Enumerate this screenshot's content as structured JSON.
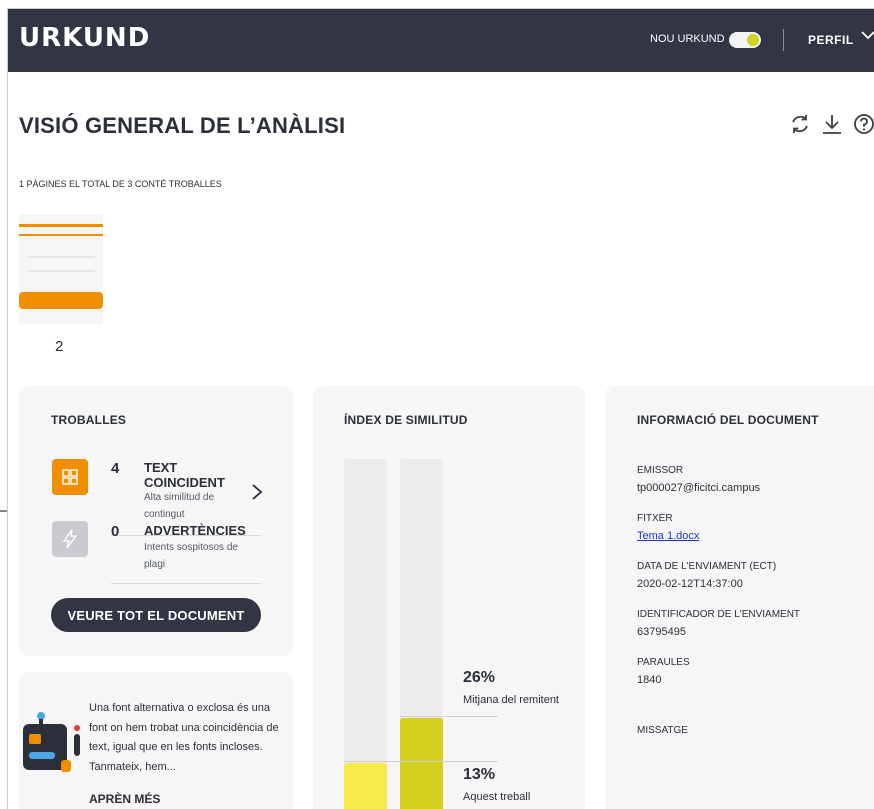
{
  "header": {
    "logo": "URKUND",
    "new_urkund_label": "NOU URKUND",
    "profile_label": "PERFIL"
  },
  "page": {
    "title": "VISIÓ GENERAL DE L’ANÀLISI",
    "subtitle": "1 PÀGINES EL TOTAL DE 3 CONTÉ TROBALLES",
    "thumbnail_number": "2"
  },
  "troballes": {
    "title": "TROBALLES",
    "items": [
      {
        "count": "4",
        "label_line1": "TEXT",
        "label_line2": "COINCIDENT",
        "desc_line1": "Alta similitud de",
        "desc_line2": "contingut",
        "icon": "grid-icon"
      },
      {
        "count": "0",
        "label_line1": "ADVERTÈNCIES",
        "desc_line1": "Intents sospitosos de",
        "desc_line2": "plagi",
        "icon": "lightning-icon"
      }
    ],
    "button_label": "VEURE TOT EL DOCUMENT"
  },
  "index": {
    "title": "ÍNDEX DE SIMILITUD",
    "avg_value": "26%",
    "avg_label": "Mitjana del remitent",
    "work_value": "13%",
    "work_label": "Aquest treball"
  },
  "chart_data": {
    "type": "bar",
    "categories": [
      "Aquest treball",
      "Mitjana del remitent"
    ],
    "values": [
      13,
      26
    ],
    "ylim": [
      0,
      100
    ]
  },
  "info": {
    "title": "INFORMACIÓ DEL DOCUMENT",
    "fields": [
      {
        "label": "EMISSOR",
        "value": "tp000027@ficitci.campus"
      },
      {
        "label": "FITXER",
        "value": "Tema 1.docx"
      },
      {
        "label": "DATA DE L'ENVIAMENT (ECT)",
        "value": "2020-02-12T14:37:00"
      },
      {
        "label": "IDENTIFICADOR DE L'ENVIAMENT",
        "value": "63795495"
      },
      {
        "label": "PARAULES",
        "value": "1840"
      },
      {
        "label": "MISSATGE",
        "value": ""
      }
    ]
  },
  "font_card": {
    "text": "Una font alternativa o exclosa és una font on hem trobat una coincidència de text, igual que en les fonts incloses. Tanmateix, hem...",
    "link_label": "APRÈN MÉS"
  },
  "colors": {
    "header_bg": "#323543",
    "accent_orange": "#f18e00",
    "bar_work": "#f7e94a",
    "bar_average": "#d4cf1d",
    "toggle_knob": "#d4cf1d",
    "link": "#2033d6"
  }
}
